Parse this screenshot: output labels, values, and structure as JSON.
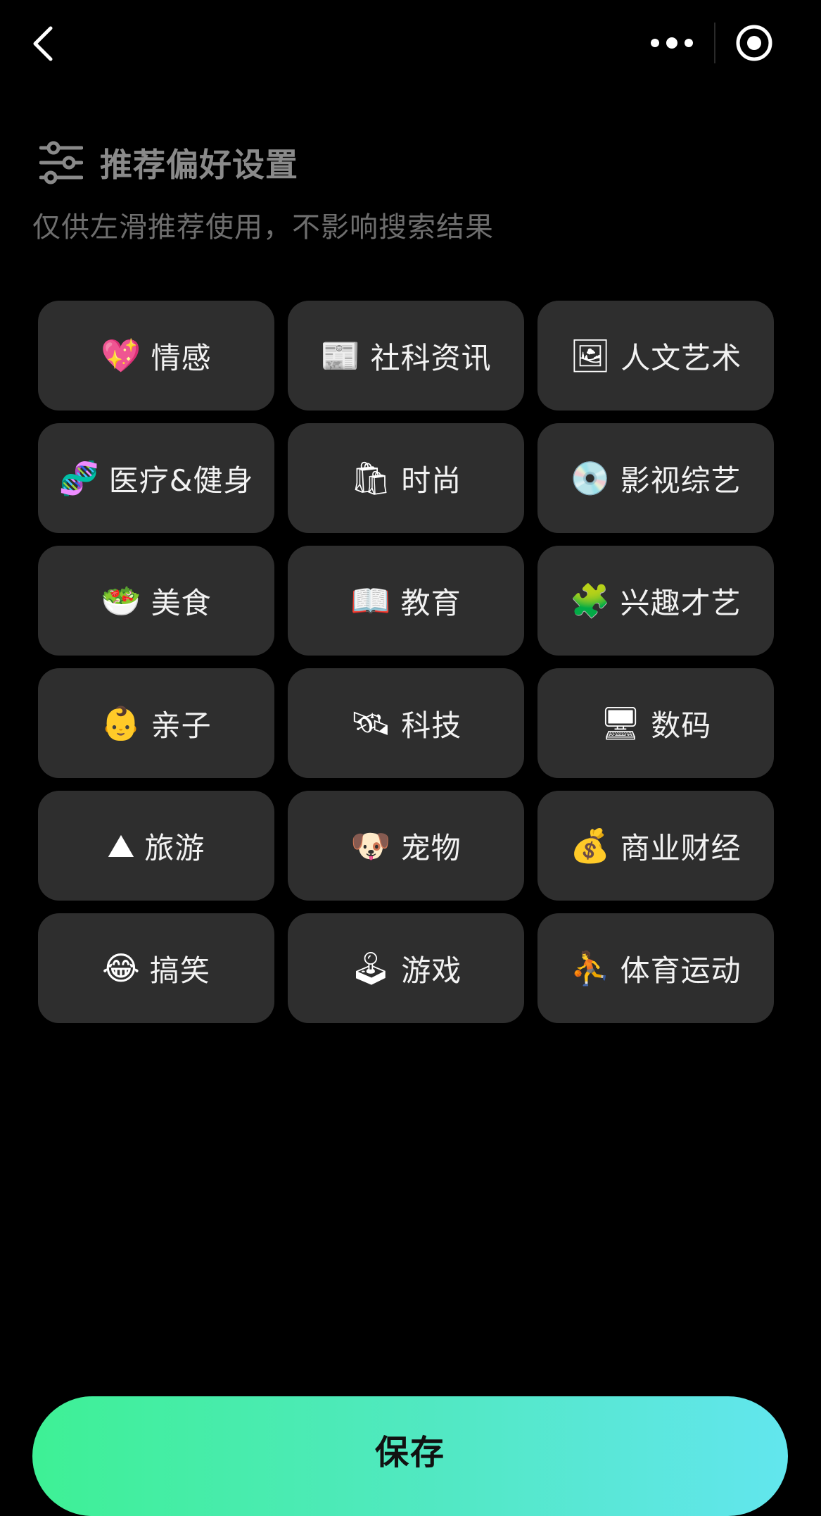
{
  "header": {
    "title": "推荐偏好设置",
    "subtitle": "仅供左滑推荐使用，不影响搜索结果"
  },
  "icons": {
    "back": "chevron-left-icon",
    "more": "more-dots-icon",
    "close": "target-circle-icon",
    "settings": "sliders-icon"
  },
  "tags": [
    {
      "icon": "💖",
      "icon_name": "sparkling-heart-icon",
      "label": "情感"
    },
    {
      "icon": "📰",
      "icon_name": "newspaper-icon",
      "label": "社科资讯"
    },
    {
      "icon": "🖼",
      "icon_name": "framed-picture-icon",
      "label": "人文艺术"
    },
    {
      "icon": "🧬",
      "icon_name": "dna-icon",
      "label": "医疗&健身"
    },
    {
      "icon": "🛍",
      "icon_name": "shopping-bags-icon",
      "label": "时尚"
    },
    {
      "icon": "💿",
      "icon_name": "optical-disc-icon",
      "label": "影视综艺"
    },
    {
      "icon": "🥗",
      "icon_name": "salad-icon",
      "label": "美食"
    },
    {
      "icon": "📖",
      "icon_name": "open-book-icon",
      "label": "教育"
    },
    {
      "icon": "🧩",
      "icon_name": "puzzle-piece-icon",
      "label": "兴趣才艺"
    },
    {
      "icon": "👶",
      "icon_name": "baby-icon",
      "label": "亲子"
    },
    {
      "icon": "🛰",
      "icon_name": "satellite-icon",
      "label": "科技"
    },
    {
      "icon": "🖥",
      "icon_name": "desktop-computer-icon",
      "label": "数码"
    },
    {
      "icon": "⛰",
      "icon_name": "mountain-icon",
      "label": "旅游"
    },
    {
      "icon": "🐶",
      "icon_name": "dog-face-icon",
      "label": "宠物"
    },
    {
      "icon": "💰",
      "icon_name": "money-bag-icon",
      "label": "商业财经"
    },
    {
      "icon": "😂",
      "icon_name": "laughing-face-icon",
      "label": "搞笑"
    },
    {
      "icon": "🕹",
      "icon_name": "joystick-icon",
      "label": "游戏"
    },
    {
      "icon": "⛹",
      "icon_name": "basketball-player-icon",
      "label": "体育运动"
    }
  ],
  "save": {
    "label": "保存"
  },
  "colors": {
    "background": "#000000",
    "tag_background": "#2e2e2e",
    "save_gradient_start": "#3ef095",
    "save_gradient_end": "#62e6ee"
  }
}
